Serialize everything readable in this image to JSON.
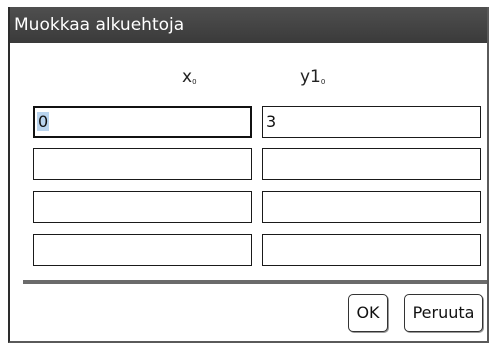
{
  "dialog": {
    "title": "Muokkaa alkuehtoja"
  },
  "columns": {
    "x_label": "x",
    "x_sub": "0",
    "y_label": "y1",
    "y_sub": "0"
  },
  "rows": [
    {
      "x": "0",
      "y": "3"
    },
    {
      "x": "",
      "y": ""
    },
    {
      "x": "",
      "y": ""
    },
    {
      "x": "",
      "y": ""
    }
  ],
  "buttons": {
    "ok": "OK",
    "cancel": "Peruuta"
  }
}
